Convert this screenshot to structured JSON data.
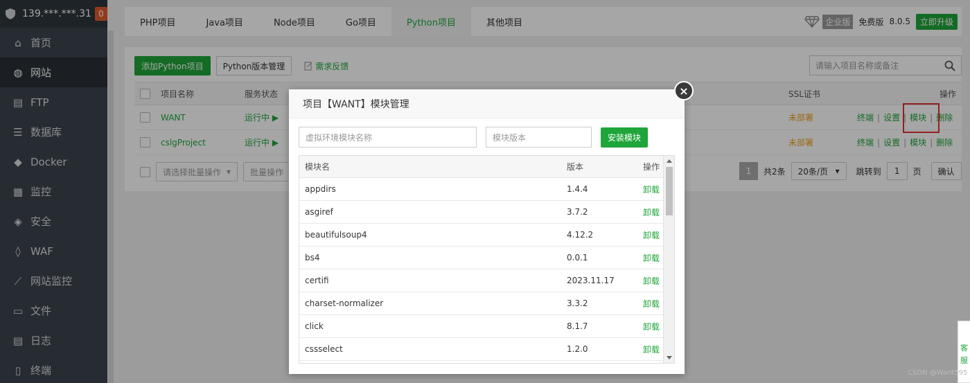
{
  "sidebar": {
    "server_ip": "139.***.***.31",
    "badge": "0",
    "items": [
      {
        "label": "首页",
        "icon": "home-icon"
      },
      {
        "label": "网站",
        "icon": "globe-icon",
        "active": true
      },
      {
        "label": "FTP",
        "icon": "ftp-icon"
      },
      {
        "label": "数据库",
        "icon": "database-icon"
      },
      {
        "label": "Docker",
        "icon": "docker-icon"
      },
      {
        "label": "监控",
        "icon": "monitor-icon"
      },
      {
        "label": "安全",
        "icon": "shield-icon"
      },
      {
        "label": "WAF",
        "icon": "waf-icon"
      },
      {
        "label": "网站监控",
        "icon": "chart-icon"
      },
      {
        "label": "文件",
        "icon": "folder-icon"
      },
      {
        "label": "日志",
        "icon": "log-icon"
      },
      {
        "label": "终端",
        "icon": "terminal-icon"
      }
    ]
  },
  "topbar": {
    "tabs": [
      "PHP项目",
      "Java项目",
      "Node项目",
      "Go项目",
      "Python项目",
      "其他项目"
    ],
    "active_tab": "Python项目",
    "edition": "企业版",
    "free": "免费版",
    "version": "8.0.5",
    "upgrade": "立即升级"
  },
  "toolbar": {
    "add_label": "添加Python项目",
    "version_mgr_label": "Python版本管理",
    "feedback_label": "需求反馈",
    "search_placeholder": "请输入项目名称或备注"
  },
  "projects_table": {
    "headers": {
      "name": "项目名称",
      "status": "服务状态",
      "ssl": "SSL证书",
      "ops": "操作"
    },
    "rows": [
      {
        "name": "WANT",
        "status": "运行中 ▶",
        "ssl": "未部署"
      },
      {
        "name": "cslgProject",
        "status": "运行中 ▶",
        "ssl": "未部署"
      }
    ],
    "ops": {
      "terminal": "终端",
      "settings": "设置",
      "module": "模块",
      "delete": "删除"
    }
  },
  "footer": {
    "batch_select": "请选择批量操作",
    "batch_btn": "批量操作",
    "page": "1",
    "total": "共2条",
    "per_page": "20条/页",
    "jump_label": "跳转到",
    "jump_value": "1",
    "page_unit": "页",
    "confirm": "确认"
  },
  "modal": {
    "title": "项目【WANT】模块管理",
    "close": "×",
    "module_placeholder": "虚拟环境模块名称",
    "version_placeholder": "模块版本",
    "install_label": "安装模块",
    "headers": {
      "name": "模块名",
      "version": "版本",
      "op": "操作"
    },
    "uninstall_label": "卸载",
    "modules": [
      {
        "name": "appdirs",
        "version": "1.4.4"
      },
      {
        "name": "asgiref",
        "version": "3.7.2"
      },
      {
        "name": "beautifulsoup4",
        "version": "4.12.2"
      },
      {
        "name": "bs4",
        "version": "0.0.1"
      },
      {
        "name": "certifi",
        "version": "2023.11.17"
      },
      {
        "name": "charset-normalizer",
        "version": "3.3.2"
      },
      {
        "name": "click",
        "version": "8.1.7"
      },
      {
        "name": "cssselect",
        "version": "1.2.0"
      }
    ]
  },
  "side_float": {
    "line1": "客",
    "line2": "服"
  },
  "watermark": "CSDN @Want595"
}
